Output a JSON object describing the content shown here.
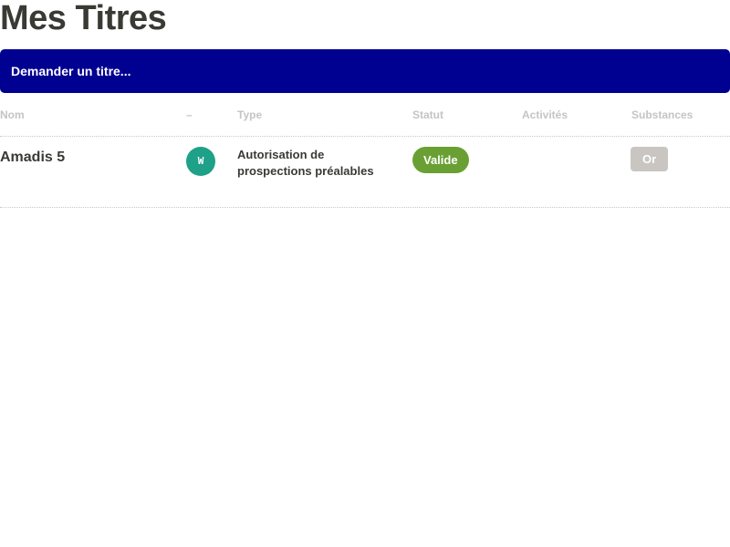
{
  "page": {
    "title": "Mes Titres"
  },
  "actions": {
    "request_label": "Demander un titre..."
  },
  "table": {
    "headers": {
      "nom": "Nom",
      "domaine": "–",
      "type": "Type",
      "statut": "Statut",
      "activites": "Activités",
      "substances": "Substances"
    },
    "rows": [
      {
        "nom": "Amadis 5",
        "domaine": "W",
        "type": "Autorisation de prospections préalables",
        "statut": "Valide",
        "activites": "",
        "substances": [
          "Or"
        ]
      }
    ]
  },
  "colors": {
    "primary": "#000091",
    "domain_badge": "#1fa088",
    "status_valid": "#6aa033",
    "substance_tag": "#c9c6c2",
    "header_text": "#c4c4c4",
    "body_text": "#3a3a35"
  }
}
